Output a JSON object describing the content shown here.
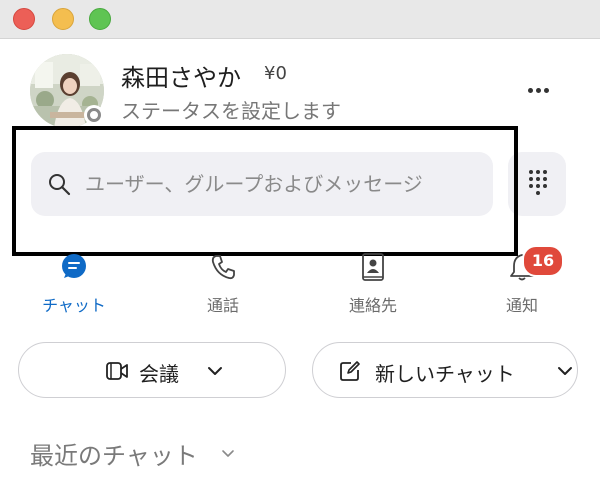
{
  "window": {
    "controls": [
      "close",
      "minimize",
      "zoom"
    ]
  },
  "profile": {
    "name": "森田さやか",
    "credit": "¥0",
    "status_prompt": "ステータスを設定します",
    "presence": "offline"
  },
  "search": {
    "placeholder": "ユーザー、グループおよびメッセージ"
  },
  "tabs": [
    {
      "label": "チャット",
      "icon": "chat-icon",
      "active": true
    },
    {
      "label": "通話",
      "icon": "phone-icon",
      "active": false
    },
    {
      "label": "連絡先",
      "icon": "contacts-icon",
      "active": false
    },
    {
      "label": "通知",
      "icon": "bell-icon",
      "active": false,
      "badge": "16"
    }
  ],
  "actions": {
    "meeting_label": "会議",
    "new_chat_label": "新しいチャット"
  },
  "recent": {
    "label": "最近のチャット"
  },
  "colors": {
    "accent": "#0f6ac6",
    "badge": "#e0493b",
    "highlight_frame": "#000000"
  }
}
